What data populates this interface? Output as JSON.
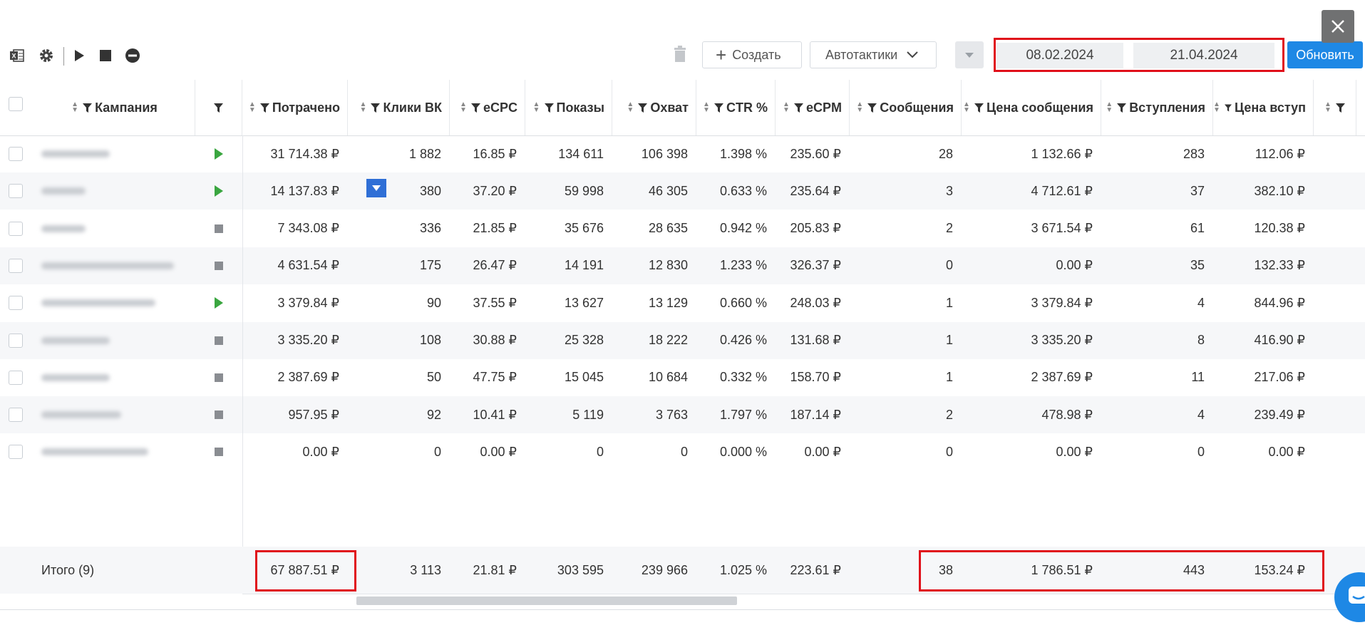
{
  "toolbar": {
    "icons": [
      "excel-icon",
      "gear-icon",
      "play-icon",
      "stop-icon",
      "minus-circle-icon"
    ],
    "trash_icon": "trash-icon",
    "create_label": "Создать",
    "autotactics_label": "Автотактики",
    "date_from": "08.02.2024",
    "date_to": "21.04.2024",
    "refresh_label": "Обновить"
  },
  "columns": [
    "Кампания",
    "Потрачено",
    "Клики ВК",
    "eCPC",
    "Показы",
    "Охват",
    "CTR %",
    "eCPM",
    "Сообщения",
    "Цена сообщения",
    "Вступления",
    "Цена вступ"
  ],
  "rows": [
    {
      "status": "play",
      "spent": "31 714.38 ₽",
      "clicks": "1 882",
      "ecpc": "16.85 ₽",
      "impr": "134 611",
      "reach": "106 398",
      "ctr": "1.398 %",
      "ecpm": "235.60 ₽",
      "msgs": "28",
      "msg_price": "1 132.66 ₽",
      "joins": "283",
      "join_price": "112.06 ₽"
    },
    {
      "status": "play",
      "spent": "14 137.83 ₽",
      "clicks": "380",
      "ecpc": "37.20 ₽",
      "impr": "59 998",
      "reach": "46 305",
      "ctr": "0.633 %",
      "ecpm": "235.64 ₽",
      "msgs": "3",
      "msg_price": "4 712.61 ₽",
      "joins": "37",
      "join_price": "382.10 ₽"
    },
    {
      "status": "stop",
      "spent": "7 343.08 ₽",
      "clicks": "336",
      "ecpc": "21.85 ₽",
      "impr": "35 676",
      "reach": "28 635",
      "ctr": "0.942 %",
      "ecpm": "205.83 ₽",
      "msgs": "2",
      "msg_price": "3 671.54 ₽",
      "joins": "61",
      "join_price": "120.38 ₽"
    },
    {
      "status": "stop",
      "spent": "4 631.54 ₽",
      "clicks": "175",
      "ecpc": "26.47 ₽",
      "impr": "14 191",
      "reach": "12 830",
      "ctr": "1.233 %",
      "ecpm": "326.37 ₽",
      "msgs": "0",
      "msg_price": "0.00 ₽",
      "joins": "35",
      "join_price": "132.33 ₽"
    },
    {
      "status": "play",
      "spent": "3 379.84 ₽",
      "clicks": "90",
      "ecpc": "37.55 ₽",
      "impr": "13 627",
      "reach": "13 129",
      "ctr": "0.660 %",
      "ecpm": "248.03 ₽",
      "msgs": "1",
      "msg_price": "3 379.84 ₽",
      "joins": "4",
      "join_price": "844.96 ₽"
    },
    {
      "status": "stop",
      "spent": "3 335.20 ₽",
      "clicks": "108",
      "ecpc": "30.88 ₽",
      "impr": "25 328",
      "reach": "18 222",
      "ctr": "0.426 %",
      "ecpm": "131.68 ₽",
      "msgs": "1",
      "msg_price": "3 335.20 ₽",
      "joins": "8",
      "join_price": "416.90 ₽"
    },
    {
      "status": "stop",
      "spent": "2 387.69 ₽",
      "clicks": "50",
      "ecpc": "47.75 ₽",
      "impr": "15 045",
      "reach": "10 684",
      "ctr": "0.332 %",
      "ecpm": "158.70 ₽",
      "msgs": "1",
      "msg_price": "2 387.69 ₽",
      "joins": "11",
      "join_price": "217.06 ₽"
    },
    {
      "status": "stop",
      "spent": "957.95 ₽",
      "clicks": "92",
      "ecpc": "10.41 ₽",
      "impr": "5 119",
      "reach": "3 763",
      "ctr": "1.797 %",
      "ecpm": "187.14 ₽",
      "msgs": "2",
      "msg_price": "478.98 ₽",
      "joins": "4",
      "join_price": "239.49 ₽"
    },
    {
      "status": "stop",
      "spent": "0.00 ₽",
      "clicks": "0",
      "ecpc": "0.00 ₽",
      "impr": "0",
      "reach": "0",
      "ctr": "0.000 %",
      "ecpm": "0.00 ₽",
      "msgs": "0",
      "msg_price": "0.00 ₽",
      "joins": "0",
      "join_price": "0.00 ₽"
    }
  ],
  "totals": {
    "label": "Итого (9)",
    "spent": "67 887.51 ₽",
    "clicks": "3 113",
    "ecpc": "21.81 ₽",
    "impr": "303 595",
    "reach": "239 966",
    "ctr": "1.025 %",
    "ecpm": "223.61 ₽",
    "msgs": "38",
    "msg_price": "1 786.51 ₽",
    "joins": "443",
    "join_price": "153.24 ₽"
  },
  "colors": {
    "accent": "#1e88e5",
    "highlight": "#e0101a",
    "play": "#3aa640"
  }
}
